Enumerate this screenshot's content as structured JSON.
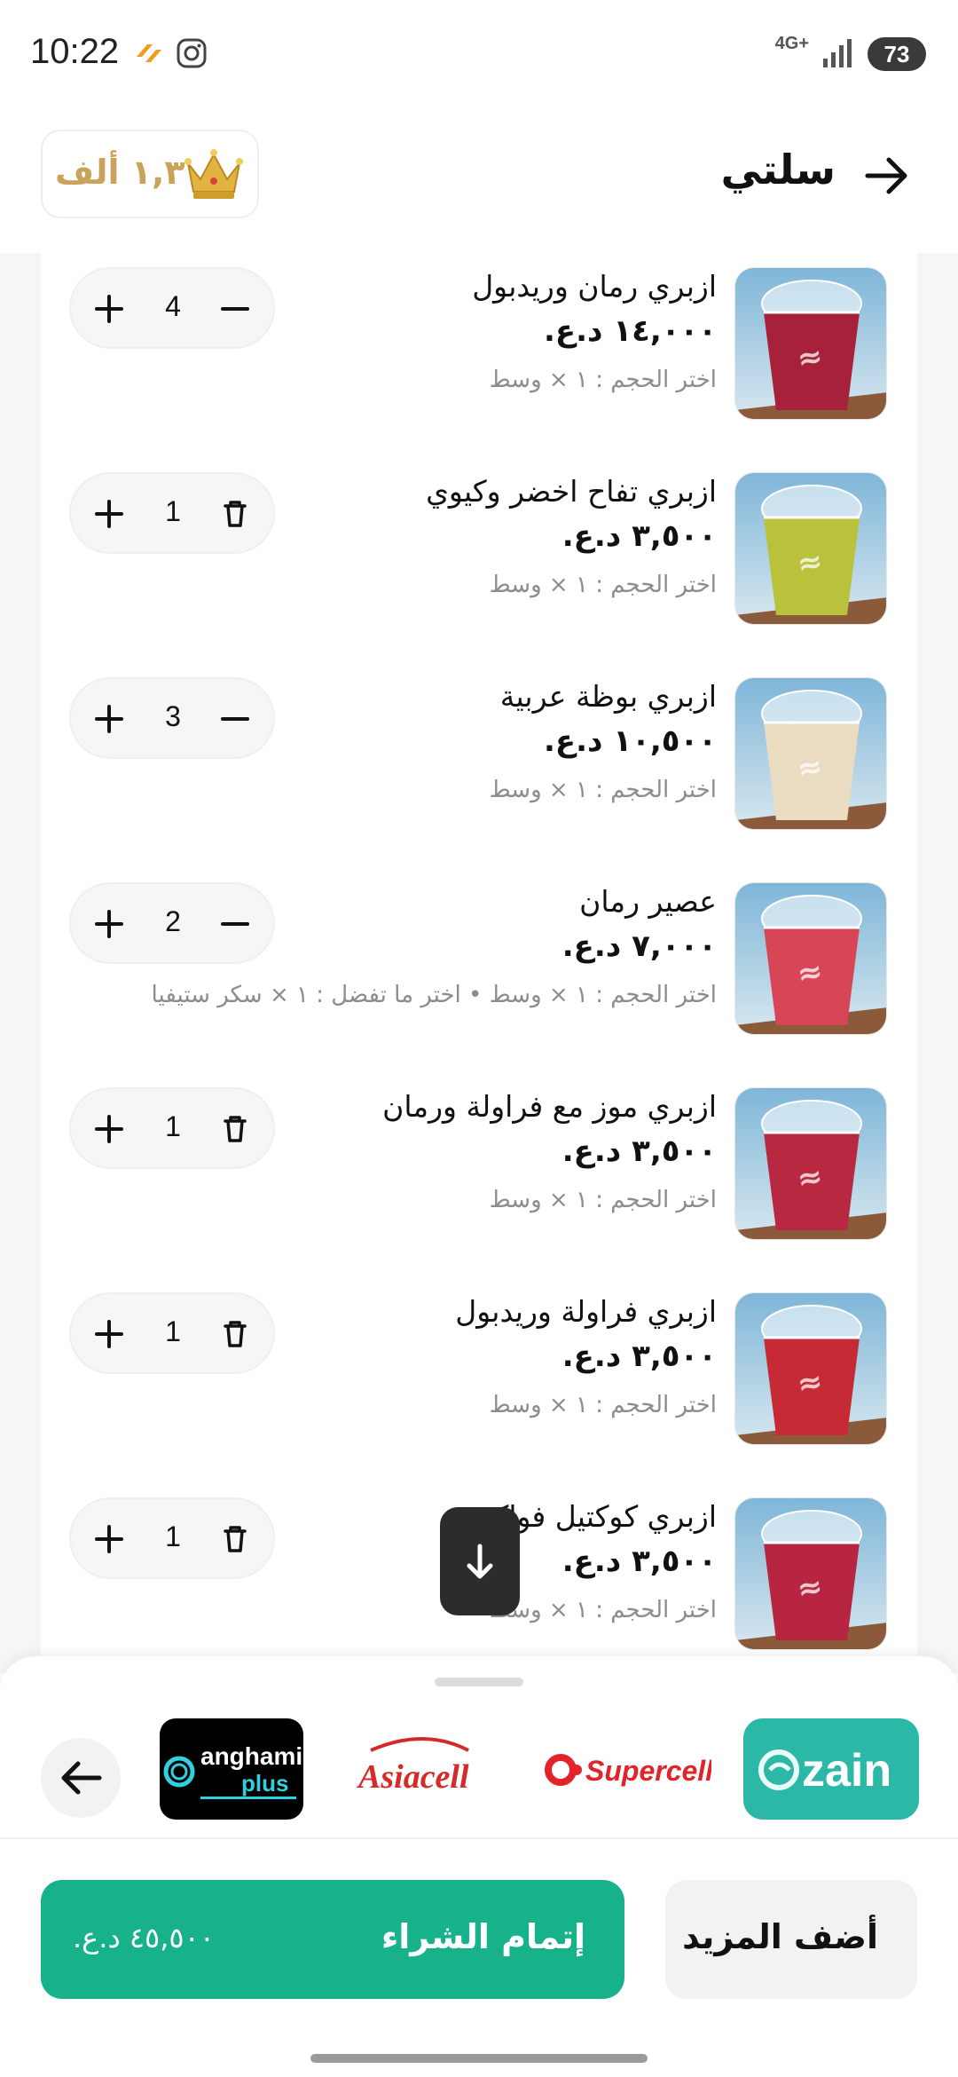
{
  "status_bar": {
    "time": "10:22",
    "network": "4G+",
    "battery": "73"
  },
  "header": {
    "title": "سلتي",
    "coins": "١,٣ ألف"
  },
  "items": [
    {
      "name": "ازبري رمان وريدبول",
      "price": "١٤,٠٠٠ د.ع.",
      "options": "اختر الحجم : ١ × وسط",
      "qty": "4",
      "right_action": "minus",
      "image_color": "#a8213a"
    },
    {
      "name": "ازبري تفاح اخضر وكيوي",
      "price": "٣,٥٠٠ د.ع.",
      "options": "اختر الحجم : ١ × وسط",
      "qty": "1",
      "right_action": "delete",
      "image_color": "#b9c23a"
    },
    {
      "name": "ازبري بوظة عربية",
      "price": "١٠,٥٠٠ د.ع.",
      "options": "اختر الحجم : ١ × وسط",
      "qty": "3",
      "right_action": "minus",
      "image_color": "#e9dcc0"
    },
    {
      "name": "عصير رمان",
      "price": "٧,٠٠٠ د.ع.",
      "options": "اختر الحجم : ١ × وسط • اختر ما تفضل : ١ × سكر ستيفيا",
      "qty": "2",
      "right_action": "minus",
      "image_color": "#d84557"
    },
    {
      "name": "ازبري موز مع فراولة ورمان",
      "price": "٣,٥٠٠ د.ع.",
      "options": "اختر الحجم : ١ × وسط",
      "qty": "1",
      "right_action": "delete",
      "image_color": "#b82840"
    },
    {
      "name": "ازبري فراولة وريدبول",
      "price": "٣,٥٠٠ د.ع.",
      "options": "اختر الحجم : ١ × وسط",
      "qty": "1",
      "right_action": "delete",
      "image_color": "#c52a35"
    },
    {
      "name": "ازبري كوكتيل فواكه",
      "price": "٣,٥٠٠ د.ع.",
      "options": "اختر الحجم : ١ × وسط",
      "qty": "1",
      "right_action": "delete",
      "image_color": "#b82540"
    }
  ],
  "partners": [
    "anghami plus",
    "Asiacell",
    "Supercell",
    "zain"
  ],
  "footer": {
    "checkout_label": "إتمام الشراء",
    "total": "٤٥,٥٠٠ د.ع.",
    "add_more_label": "أضف المزيد"
  },
  "colors": {
    "accent": "#17b18a",
    "coins": "#c9a35a",
    "zain": "#2bb8a6",
    "asiacell": "#d42a2a",
    "supercell": "#e1232a"
  }
}
